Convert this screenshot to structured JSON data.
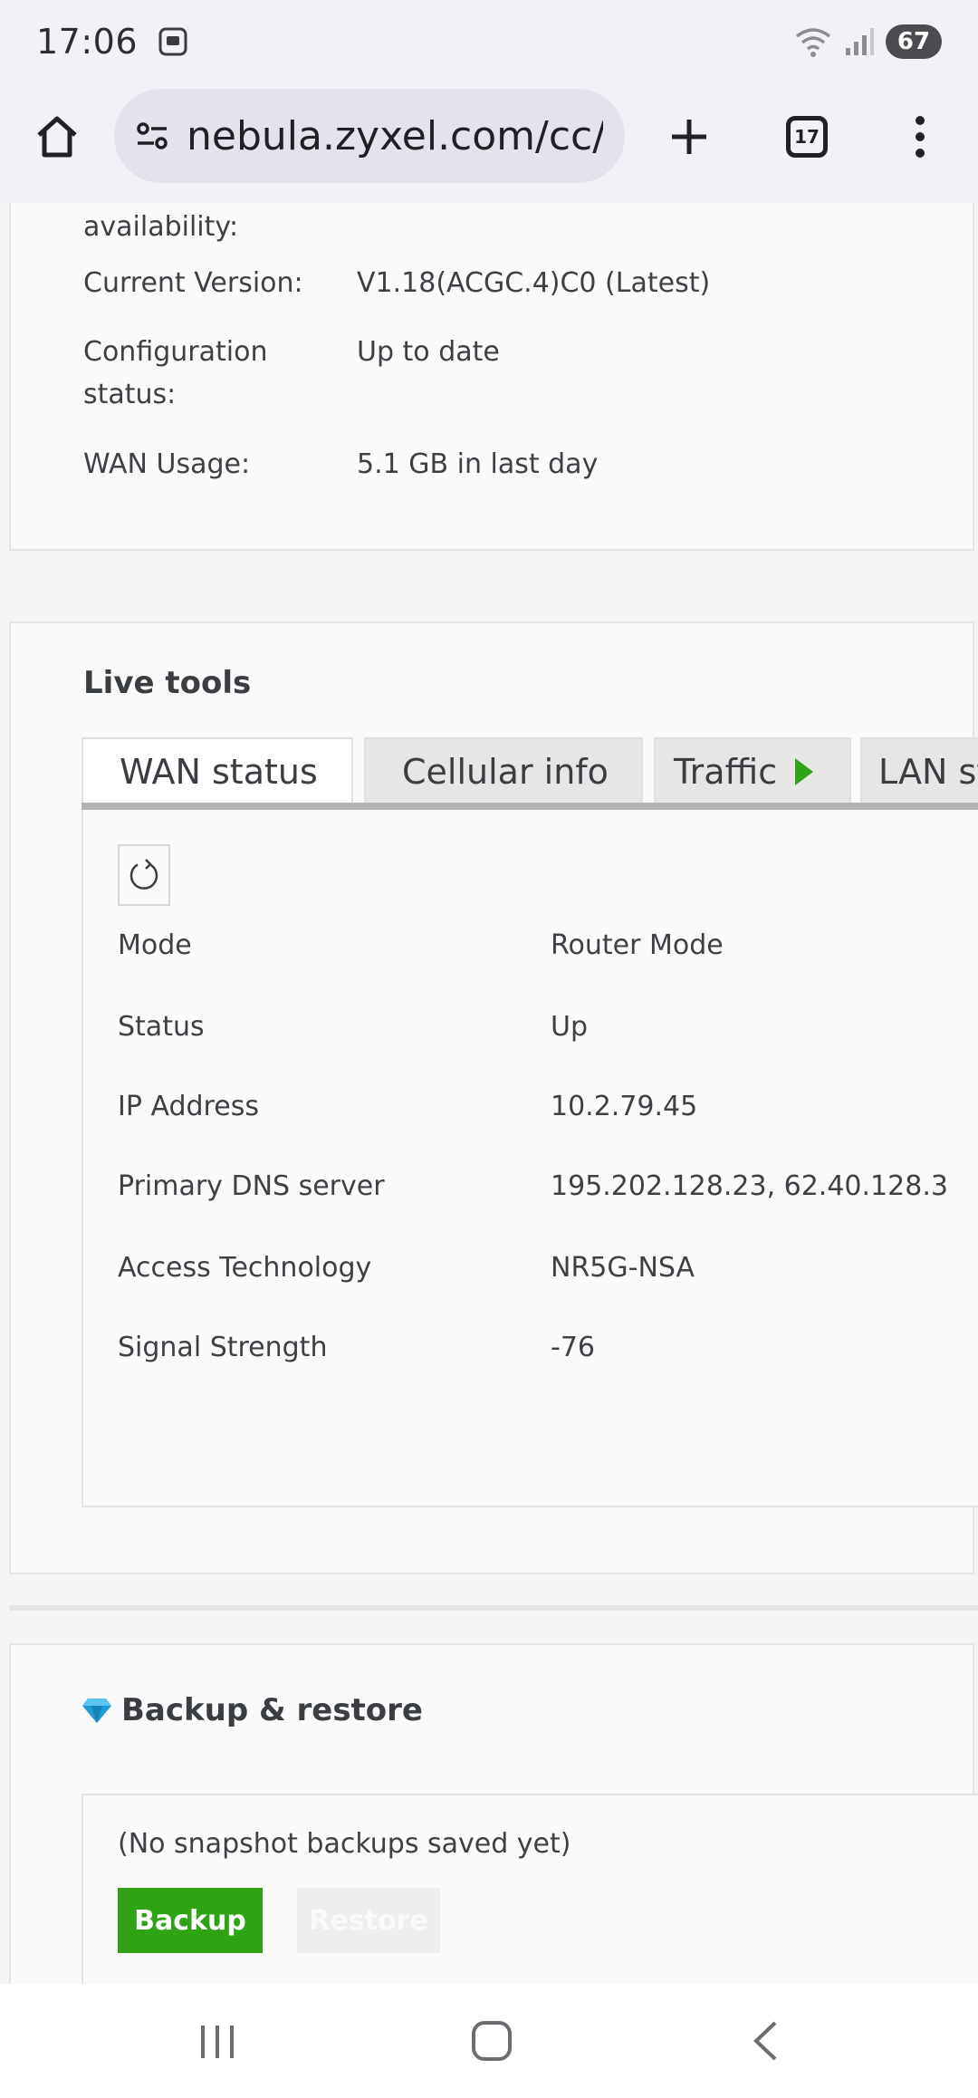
{
  "status_bar": {
    "time": "17:06",
    "battery": "67",
    "icons": [
      "screenshot-icon",
      "wifi-icon",
      "signal-icon"
    ]
  },
  "browser": {
    "url": "nebula.zyxel.com/cc/u",
    "tabs_count": "17"
  },
  "device_info": {
    "rows": [
      {
        "label": "availability:",
        "value": ""
      },
      {
        "label": "Current Version:",
        "value": "V1.18(ACGC.4)C0 (Latest)"
      },
      {
        "label": "Configuration",
        "label2": "status:",
        "value": "Up to date"
      },
      {
        "label": "WAN Usage:",
        "value": "5.1 GB in last day"
      }
    ]
  },
  "live_tools": {
    "title": "Live tools",
    "tabs": [
      {
        "label": "WAN status"
      },
      {
        "label": "Cellular info"
      },
      {
        "label": "Traffic"
      },
      {
        "label": "LAN st"
      }
    ],
    "wan_status": [
      {
        "key": "Mode",
        "value": "Router Mode"
      },
      {
        "key": "Status",
        "value": "Up"
      },
      {
        "key": "IP Address",
        "value": "10.2.79.45"
      },
      {
        "key": "Primary DNS server",
        "value": "195.202.128.23, 62.40.128.3"
      },
      {
        "key": "Access Technology",
        "value": "NR5G-NSA"
      },
      {
        "key": "Signal Strength",
        "value": "-76"
      }
    ]
  },
  "backup": {
    "title": "Backup & restore",
    "empty_message": "(No snapshot backups saved yet)",
    "backup_label": "Backup",
    "restore_label": "Restore"
  },
  "colors": {
    "accent_green": "#2ea314",
    "gem_blue": "#1e9bd7"
  }
}
